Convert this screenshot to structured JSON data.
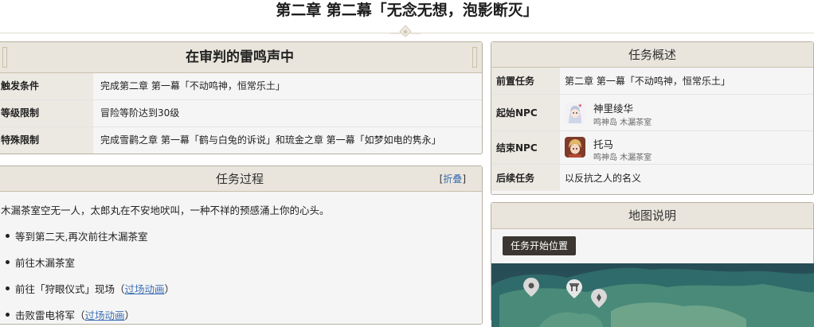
{
  "page": {
    "title": "第二章 第二幕「无念无想，泡影断灭」"
  },
  "trigger": {
    "title": "在审判的雷鸣声中",
    "rows": [
      {
        "label": "触发条件",
        "value": "完成第二章 第一幕「不动鸣神，恒常乐土」"
      },
      {
        "label": "等级限制",
        "value": "冒险等阶达到30级"
      },
      {
        "label": "特殊限制",
        "value": "完成雪鹳之章 第一幕「鹤与白兔的诉说」和琉金之章 第一幕「如梦如电的隽永」"
      }
    ]
  },
  "process": {
    "title": "任务过程",
    "collapse_open": "[",
    "collapse_label": "折叠",
    "collapse_close": "]",
    "intro": "木漏茶室空无一人，太郎丸在不安地吠叫，一种不祥的预感涌上你的心头。",
    "items": [
      {
        "text": "等到第二天,再次前往木漏茶室",
        "link": "",
        "suffix": ""
      },
      {
        "text": "前往木漏茶室",
        "link": "",
        "suffix": ""
      },
      {
        "text": "前往「狩眼仪式」现场（",
        "link": "过场动画",
        "suffix": "）"
      },
      {
        "text": "击败雷电将军（",
        "link": "过场动画",
        "suffix": "）"
      }
    ]
  },
  "summary": {
    "title": "任务概述",
    "prev_label": "前置任务",
    "prev_value": "第二章 第一幕「不动鸣神，恒常乐土」",
    "start_label": "起始NPC",
    "start_npc_name": "神里绫华",
    "start_npc_loc": "鸣神岛 木漏茶室",
    "end_label": "结束NPC",
    "end_npc_name": "托马",
    "end_npc_loc": "鸣神岛 木漏茶室",
    "next_label": "后续任务",
    "next_value": "以反抗之人的名义"
  },
  "map": {
    "title": "地图说明",
    "start_button": "任务开始位置"
  },
  "colors": {
    "panel_head": "#e9e5dc",
    "label_bg": "#ece9e2",
    "link": "#3c6eb4",
    "button": "#3b3631"
  }
}
